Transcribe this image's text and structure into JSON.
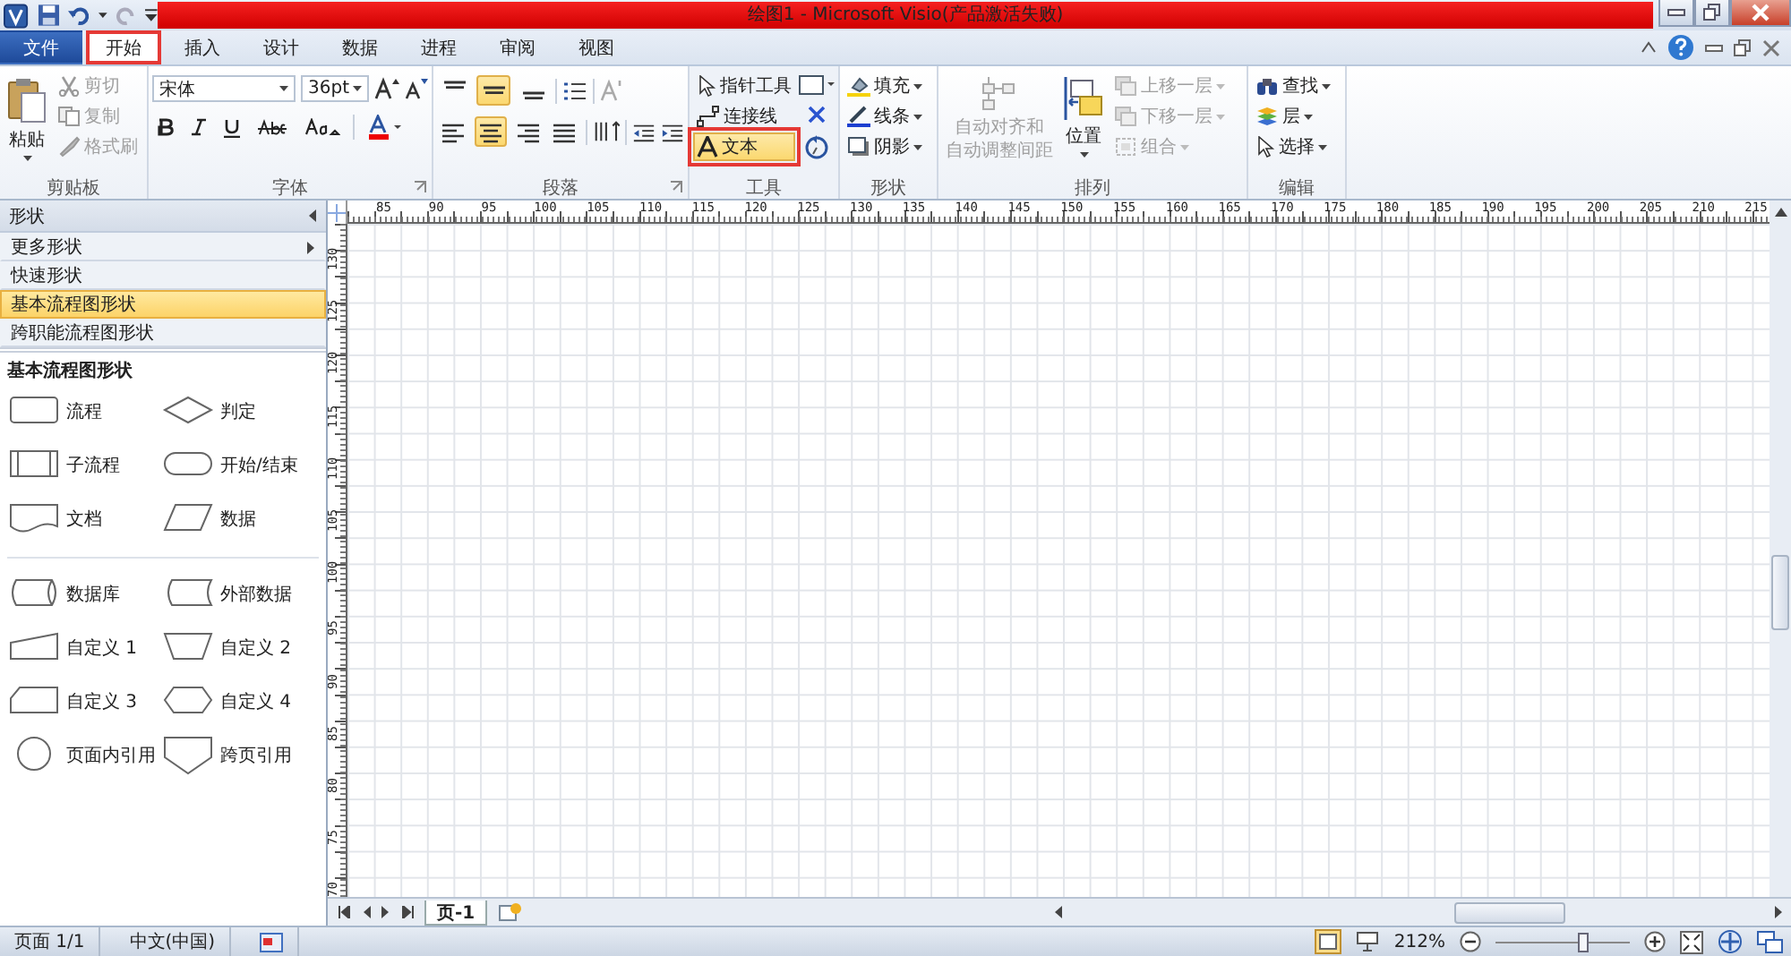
{
  "title_bar": {
    "title": "绘图1 - Microsoft Visio(产品激活失败)"
  },
  "tabs": [
    {
      "label": "文件",
      "kind": "file",
      "selected": false,
      "marked": false
    },
    {
      "label": "开始",
      "kind": "tab",
      "selected": true,
      "marked": true
    },
    {
      "label": "插入",
      "kind": "tab",
      "selected": false,
      "marked": false
    },
    {
      "label": "设计",
      "kind": "tab",
      "selected": false,
      "marked": false
    },
    {
      "label": "数据",
      "kind": "tab",
      "selected": false,
      "marked": false
    },
    {
      "label": "进程",
      "kind": "tab",
      "selected": false,
      "marked": false
    },
    {
      "label": "审阅",
      "kind": "tab",
      "selected": false,
      "marked": false
    },
    {
      "label": "视图",
      "kind": "tab",
      "selected": false,
      "marked": false
    }
  ],
  "ribbon": {
    "clipboard": {
      "label": "剪贴板",
      "paste": "粘贴",
      "commands": [
        {
          "label": "剪切",
          "disabled": true
        },
        {
          "label": "复制",
          "disabled": true
        },
        {
          "label": "格式刷",
          "disabled": true
        }
      ]
    },
    "font": {
      "label": "字体",
      "font_name": "宋体",
      "font_size": "36pt"
    },
    "paragraph": {
      "label": "段落",
      "vertical_align": [
        {
          "selected": false
        },
        {
          "selected": true
        },
        {
          "selected": false
        }
      ],
      "horizontal_align": [
        {
          "selected": false
        },
        {
          "selected": true
        },
        {
          "selected": false
        },
        {
          "selected": false
        }
      ]
    },
    "tools": {
      "label": "工具",
      "commands": [
        {
          "label": "指针工具",
          "selected": false,
          "marked": false
        },
        {
          "label": "连接线",
          "selected": false,
          "marked": false
        },
        {
          "label": "文本",
          "selected": true,
          "marked": true
        }
      ]
    },
    "shape": {
      "label": "形状",
      "commands": [
        {
          "label": "填充"
        },
        {
          "label": "线条"
        },
        {
          "label": "阴影"
        }
      ]
    },
    "arrange": {
      "label": "排列",
      "auto_align": {
        "lines": [
          "自动对齐和",
          "自动调整间距"
        ],
        "disabled": true
      },
      "position": "位置",
      "commands": [
        {
          "label": "上移一层",
          "disabled": true
        },
        {
          "label": "下移一层",
          "disabled": true
        },
        {
          "label": "组合",
          "disabled": true
        }
      ]
    },
    "editing": {
      "label": "编辑",
      "commands": [
        {
          "label": "查找"
        },
        {
          "label": "层"
        },
        {
          "label": "选择"
        }
      ]
    }
  },
  "shapes_pane": {
    "title": "形状",
    "nav": [
      {
        "label": "更多形状",
        "selected": false,
        "submenu": true
      },
      {
        "label": "快速形状",
        "selected": false,
        "submenu": false
      },
      {
        "label": "基本流程图形状",
        "selected": true,
        "submenu": false
      },
      {
        "label": "跨职能流程图形状",
        "selected": false,
        "submenu": false
      }
    ],
    "stencil_title": "基本流程图形状",
    "sections": [
      [
        {
          "label": "流程",
          "kind": "process"
        },
        {
          "label": "判定",
          "kind": "decision"
        },
        {
          "label": "子流程",
          "kind": "subprocess"
        },
        {
          "label": "开始/结束",
          "kind": "terminator"
        },
        {
          "label": "文档",
          "kind": "document"
        },
        {
          "label": "数据",
          "kind": "data"
        }
      ],
      [
        {
          "label": "数据库",
          "kind": "database"
        },
        {
          "label": "外部数据",
          "kind": "external"
        },
        {
          "label": "自定义 1",
          "kind": "custom1"
        },
        {
          "label": "自定义 2",
          "kind": "custom2"
        },
        {
          "label": "自定义 3",
          "kind": "custom3"
        },
        {
          "label": "自定义 4",
          "kind": "custom4"
        },
        {
          "label": "页面内引用",
          "kind": "onpage"
        },
        {
          "label": "跨页引用",
          "kind": "offpage"
        }
      ]
    ]
  },
  "rulers": {
    "horizontal": [
      "85",
      "90",
      "95",
      "100",
      "105",
      "110",
      "115",
      "120",
      "125",
      "130",
      "135",
      "140",
      "145",
      "150",
      "155",
      "160",
      "165",
      "170",
      "175",
      "180",
      "185",
      "190",
      "195",
      "200",
      "205",
      "210",
      "215"
    ],
    "vertical": [
      "130",
      "125",
      "120",
      "115",
      "110",
      "105",
      "100",
      "95",
      "90",
      "85",
      "80",
      "75",
      "70"
    ]
  },
  "page_tabs": [
    {
      "label": "页-1",
      "selected": true
    }
  ],
  "status_bar": {
    "page": "页面 1/1",
    "language": "中文(中国)",
    "zoom": "212%",
    "zoom_slider": {
      "level": 0.65
    }
  }
}
